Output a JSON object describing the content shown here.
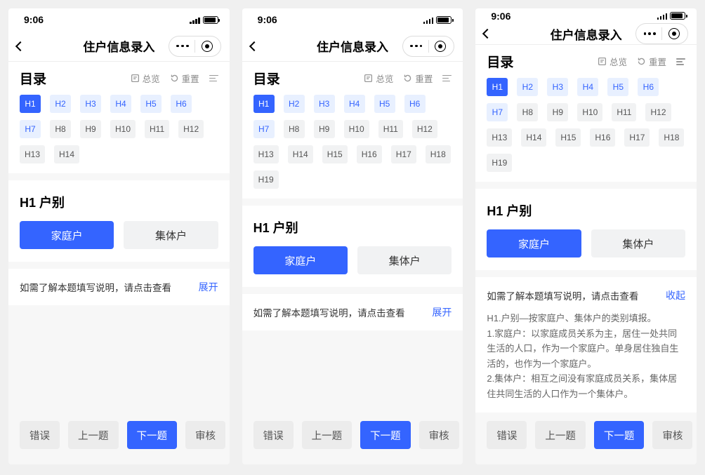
{
  "status": {
    "time": "9:06"
  },
  "nav": {
    "title": "住户信息录入"
  },
  "catalog": {
    "title": "目录",
    "overview_label": "总览",
    "reset_label": "重置",
    "variant_a": {
      "chips": [
        "H1",
        "H2",
        "H3",
        "H4",
        "H5",
        "H6",
        "H7",
        "H8",
        "H9",
        "H10",
        "H11",
        "H12",
        "H13",
        "H14"
      ]
    },
    "variant_b": {
      "chips": [
        "H1",
        "H2",
        "H3",
        "H4",
        "H5",
        "H6",
        "H7",
        "H8",
        "H9",
        "H10",
        "H11",
        "H12",
        "H13",
        "H14",
        "H15",
        "H16",
        "H17",
        "H18",
        "H19"
      ]
    }
  },
  "question": {
    "title": "H1 户别",
    "options": {
      "family": "家庭户",
      "collective": "集体户"
    }
  },
  "help": {
    "prompt": "如需了解本题填写说明，请点击查看",
    "expand": "展开",
    "collapse": "收起",
    "body_lines": [
      "H1.户别—按家庭户、集体户的类别填报。",
      "1.家庭户：以家庭成员关系为主，居住一处共同生活的人口，作为一个家庭户。单身居住独自生活的，也作为一个家庭户。",
      "2.集体户：相互之间没有家庭成员关系，集体居住共同生活的人口作为一个集体户。"
    ]
  },
  "footer": {
    "error": "错误",
    "prev": "上一题",
    "next": "下一题",
    "audit": "审核"
  }
}
